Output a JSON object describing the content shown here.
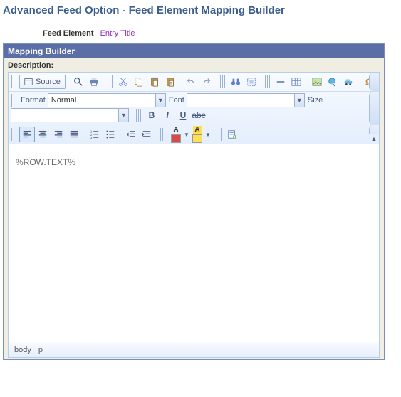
{
  "page_title": "Advanced Feed Option - Feed Element Mapping Builder",
  "feed": {
    "label": "Feed Element",
    "value": "Entry Title"
  },
  "panel": {
    "header": "Mapping Builder",
    "description_label": "Description:"
  },
  "toolbar": {
    "source_label": "Source",
    "format_label": "Format",
    "format_value": "Normal",
    "font_label": "Font",
    "font_value": "",
    "size_label": "Size",
    "size_value": ""
  },
  "editor": {
    "content": "%ROW.TEXT%"
  },
  "status": {
    "path1": "body",
    "path2": "p"
  }
}
